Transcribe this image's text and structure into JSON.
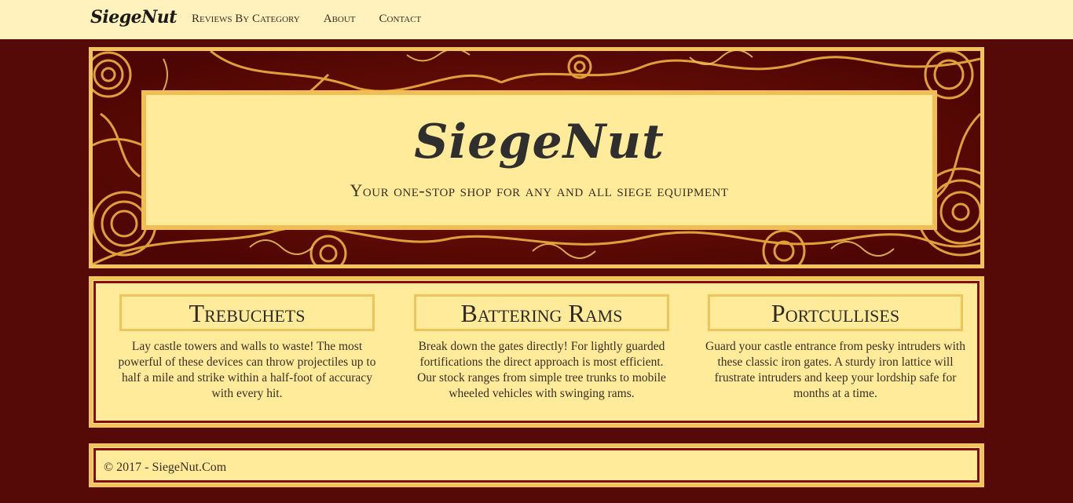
{
  "navbar": {
    "brand": "SiegeNut",
    "links": [
      "Reviews By Category",
      "About",
      "Contact"
    ]
  },
  "hero": {
    "title": "SiegeNut",
    "subtitle": "Your one-stop shop for any and all siege equipment"
  },
  "categories": [
    {
      "title": "Trebuchets",
      "text": "Lay castle towers and walls to waste! The most powerful of these devices can throw projectiles up to half a mile and strike within a half-foot of accuracy with every hit."
    },
    {
      "title": "Battering Rams",
      "text": "Break down the gates directly! For lightly guarded fortifications the direct approach is most efficient. Our stock ranges from simple tree trunks to mobile wheeled vehicles with swinging rams."
    },
    {
      "title": "Portcullises",
      "text": "Guard your castle entrance from pesky intruders with these classic iron gates. A sturdy iron lattice will frustrate intruders and keep your lordship safe for months at a time."
    }
  ],
  "footer": {
    "text": "© 2017 - SiegeNut.Com"
  },
  "colors": {
    "background": "#560a07",
    "navbar": "#fff2bd",
    "panel": "#ffeb99",
    "gold": "#f2c45c",
    "deep_red": "#8a0a04"
  }
}
